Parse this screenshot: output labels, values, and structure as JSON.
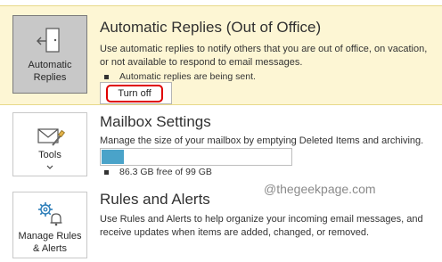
{
  "automatic_replies": {
    "tile_label": "Automatic Replies",
    "title": "Automatic Replies (Out of Office)",
    "description": "Use automatic replies to notify others that you are out of office, on vacation, or not available to respond to email messages.",
    "status": "Automatic replies are being sent.",
    "turn_off_label": "Turn off"
  },
  "mailbox_settings": {
    "tile_label": "Tools",
    "title": "Mailbox Settings",
    "description": "Manage the size of your mailbox by emptying Deleted Items and archiving.",
    "quota_text": "86.3 GB free of 99 GB",
    "used_fraction": 0.128
  },
  "rules_alerts": {
    "tile_label_line1": "Manage Rules",
    "tile_label_line2": "& Alerts",
    "title": "Rules and Alerts",
    "description": "Use Rules and Alerts to help organize your incoming email messages, and receive updates when items are added, changed, or removed."
  },
  "watermark": "@thegeekpage.com",
  "colors": {
    "highlight_bg": "#fdf6d4",
    "tile_selected_bg": "#c8c8c8",
    "progress_fill": "#4aa3c9",
    "annotation_red": "#e00000"
  }
}
